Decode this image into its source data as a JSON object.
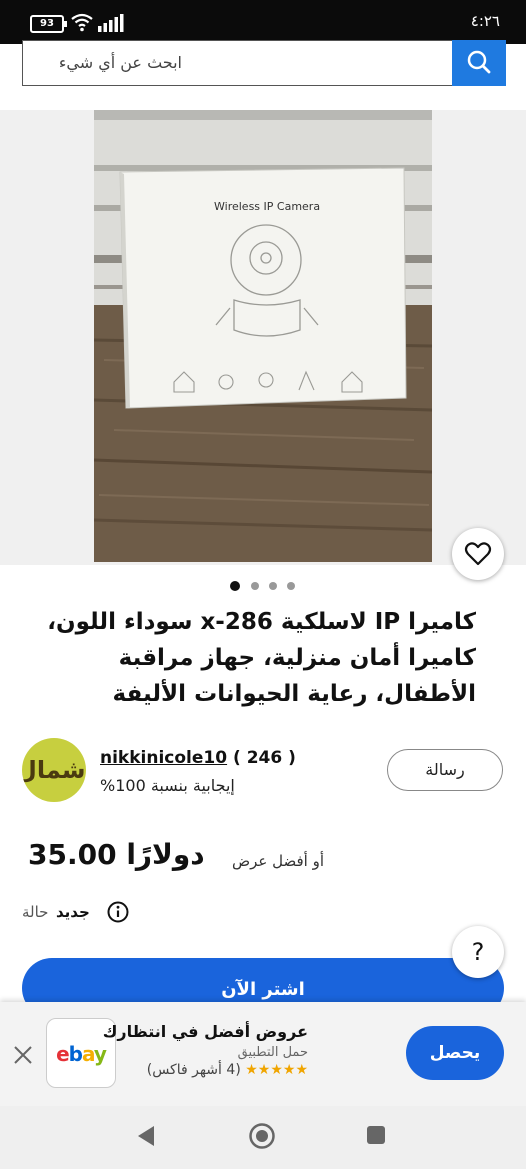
{
  "status_bar": {
    "battery": "93",
    "time": "٤:٢٦"
  },
  "search": {
    "placeholder": "ابحث عن أي شيء"
  },
  "gallery": {
    "box_text": "Wireless IP Camera",
    "dots_count": 4,
    "active_dot": 0
  },
  "product": {
    "title": "كاميرا IP لاسلكية x-286 سوداء اللون، كاميرا أمان منزلية، جهاز مراقبة الأطفال، رعاية الحيوانات الأليفة"
  },
  "seller": {
    "avatar_text": "شمال",
    "name": "nikkinicole10",
    "feedback_count": "( 246 )",
    "rating": "إيجابية بنسبة 100%",
    "message_label": "رسالة"
  },
  "price": {
    "amount": "35.00 دولارًا",
    "best_offer": "أو أفضل عرض"
  },
  "condition": {
    "label": "حالة",
    "value": "جديد"
  },
  "help": {
    "label": "?"
  },
  "buy": {
    "label": "اشتر الآن"
  },
  "app_banner": {
    "title": "عروض أفضل في انتظارك",
    "subtitle": "حمل التطبيق",
    "stars": "★★★★★",
    "reviews": "(4 أشهر فاكس)",
    "logo_letters": [
      "e",
      "b",
      "a",
      "y"
    ],
    "get_label": "يحصل"
  },
  "colors": {
    "accent": "#1a64dc",
    "search_button": "#1f7ae0",
    "ebay_e": "#e53238",
    "ebay_b": "#0064d2",
    "ebay_a": "#f5af02",
    "ebay_y": "#86b817"
  },
  "icons": [
    "battery-icon",
    "wifi-icon",
    "signal-icon",
    "search-icon",
    "heart-icon",
    "info-icon",
    "close-icon",
    "back-icon",
    "home-icon",
    "recents-icon"
  ]
}
